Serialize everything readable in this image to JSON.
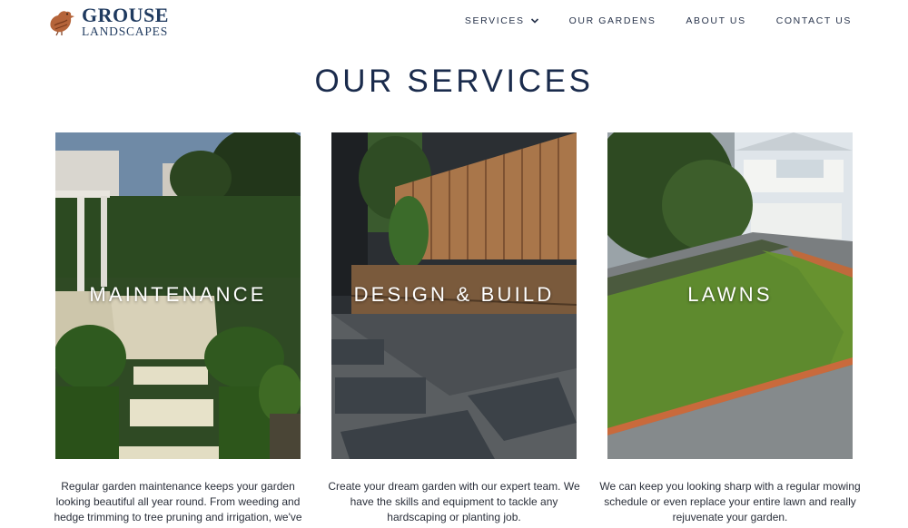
{
  "brand": {
    "line1": "GROUSE",
    "line2": "LANDSCAPES"
  },
  "nav": {
    "services": "SERVICES",
    "our_gardens": "OUR GARDENS",
    "about_us": "ABOUT US",
    "contact_us": "CONTACT US"
  },
  "page_title": "OUR SERVICES",
  "services": [
    {
      "label": "MAINTENANCE",
      "description": "Regular garden maintenance keeps your garden looking beautiful all year round. From weeding and hedge trimming to tree pruning and irrigation, we've"
    },
    {
      "label": "DESIGN & BUILD",
      "description": "Create your dream garden with our expert team. We have the skills and equipment to tackle any hardscaping or planting job."
    },
    {
      "label": "LAWNS",
      "description": "We can keep you looking sharp with a regular mowing schedule or even replace your entire lawn and really rejuvenate your garden."
    }
  ],
  "colors": {
    "navy": "#1a2b4c",
    "logo_bird": "#b5643a"
  }
}
